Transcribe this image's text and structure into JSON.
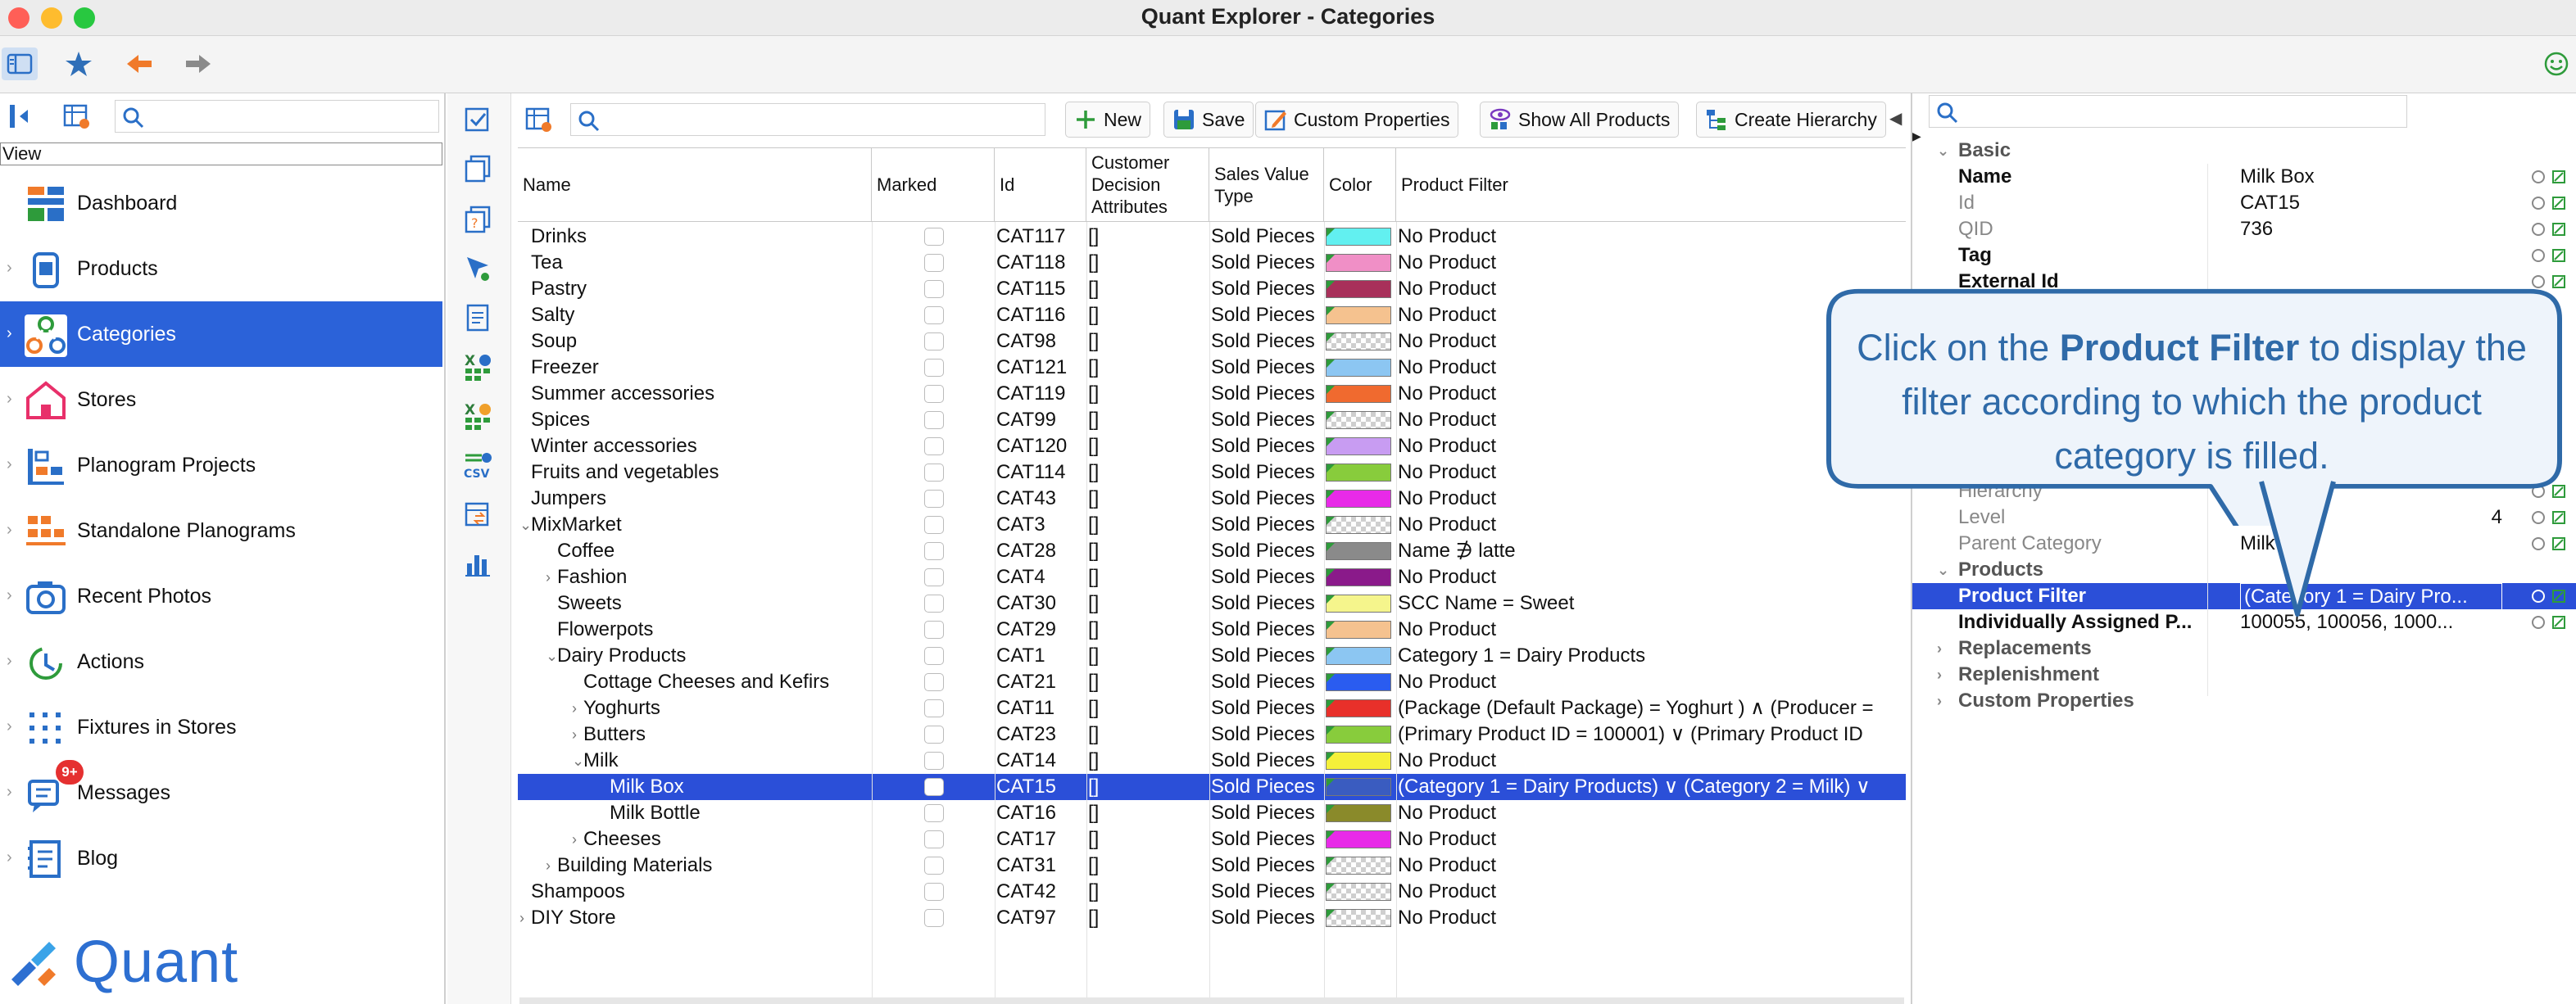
{
  "window": {
    "title": "Quant Explorer - Categories"
  },
  "left_panel": {
    "view_label": "View",
    "nav_items": [
      {
        "label": "Dashboard",
        "icon": "dashboard-icon"
      },
      {
        "label": "Products",
        "icon": "products-icon"
      },
      {
        "label": "Categories",
        "icon": "categories-icon"
      },
      {
        "label": "Stores",
        "icon": "stores-icon"
      },
      {
        "label": "Planogram Projects",
        "icon": "planogram-projects-icon"
      },
      {
        "label": "Standalone Planograms",
        "icon": "standalone-planograms-icon"
      },
      {
        "label": "Recent Photos",
        "icon": "camera-icon"
      },
      {
        "label": "Actions",
        "icon": "actions-icon"
      },
      {
        "label": "Fixtures in Stores",
        "icon": "fixtures-icon"
      },
      {
        "label": "Messages",
        "icon": "messages-icon"
      },
      {
        "label": "Blog",
        "icon": "blog-icon"
      }
    ],
    "messages_badge": "9+",
    "logo_text": "Quant",
    "selected": "Categories"
  },
  "toolbar": {
    "new_label": "New",
    "save_label": "Save",
    "custom_properties_label": "Custom Properties",
    "show_all_products_label": "Show All Products",
    "create_hierarchy_label": "Create Hierarchy"
  },
  "table": {
    "columns": [
      "Name",
      "Marked",
      "Id",
      "Customer Decision Attributes",
      "Sales Value Type",
      "Color",
      "Product Filter"
    ],
    "rows": [
      {
        "name": "Drinks",
        "indent": 0,
        "expander": "",
        "id": "CAT117",
        "cda": "[]",
        "svt": "Sold Pieces",
        "color": "#62f0f0",
        "filter": "No Product"
      },
      {
        "name": "Tea",
        "indent": 0,
        "expander": "",
        "id": "CAT118",
        "cda": "[]",
        "svt": "Sold Pieces",
        "color": "#f08fc6",
        "filter": "No Product"
      },
      {
        "name": "Pastry",
        "indent": 0,
        "expander": "",
        "id": "CAT115",
        "cda": "[]",
        "svt": "Sold Pieces",
        "color": "#a8305a",
        "filter": "No Product"
      },
      {
        "name": "Salty",
        "indent": 0,
        "expander": "",
        "id": "CAT116",
        "cda": "[]",
        "svt": "Sold Pieces",
        "color": "#f5c28f",
        "filter": "No Product"
      },
      {
        "name": "Soup",
        "indent": 0,
        "expander": "",
        "id": "CAT98",
        "cda": "[]",
        "svt": "Sold Pieces",
        "color": "checker",
        "filter": "No Product"
      },
      {
        "name": "Freezer",
        "indent": 0,
        "expander": "",
        "id": "CAT121",
        "cda": "[]",
        "svt": "Sold Pieces",
        "color": "#8cc6f2",
        "filter": "No Product"
      },
      {
        "name": "Summer accessories",
        "indent": 0,
        "expander": "",
        "id": "CAT119",
        "cda": "[]",
        "svt": "Sold Pieces",
        "color": "#f06a2f",
        "filter": "No Product"
      },
      {
        "name": "Spices",
        "indent": 0,
        "expander": "",
        "id": "CAT99",
        "cda": "[]",
        "svt": "Sold Pieces",
        "color": "checker",
        "filter": "No Product"
      },
      {
        "name": "Winter accessories",
        "indent": 0,
        "expander": "",
        "id": "CAT120",
        "cda": "[]",
        "svt": "Sold Pieces",
        "color": "#c89cf2",
        "filter": "No Product"
      },
      {
        "name": "Fruits and vegetables",
        "indent": 0,
        "expander": "",
        "id": "CAT114",
        "cda": "[]",
        "svt": "Sold Pieces",
        "color": "#88cc3c",
        "filter": "No Product"
      },
      {
        "name": "Jumpers",
        "indent": 0,
        "expander": "",
        "id": "CAT43",
        "cda": "[]",
        "svt": "Sold Pieces",
        "color": "#e82ae8",
        "filter": "No Product"
      },
      {
        "name": "MixMarket",
        "indent": 0,
        "expander": "v",
        "id": "CAT3",
        "cda": "[]",
        "svt": "Sold Pieces",
        "color": "checker",
        "filter": "No Product"
      },
      {
        "name": "Coffee",
        "indent": 1,
        "expander": "",
        "id": "CAT28",
        "cda": "[]",
        "svt": "Sold Pieces",
        "color": "#8a8a8a",
        "filter": "Name ∌ latte"
      },
      {
        "name": "Fashion",
        "indent": 1,
        "expander": ">",
        "id": "CAT4",
        "cda": "[]",
        "svt": "Sold Pieces",
        "color": "#8a1a8a",
        "filter": "No Product"
      },
      {
        "name": "Sweets",
        "indent": 1,
        "expander": "",
        "id": "CAT30",
        "cda": "[]",
        "svt": "Sold Pieces",
        "color": "#f5f58c",
        "filter": "SCC Name = Sweet"
      },
      {
        "name": "Flowerpots",
        "indent": 1,
        "expander": "",
        "id": "CAT29",
        "cda": "[]",
        "svt": "Sold Pieces",
        "color": "#f5c28f",
        "filter": "No Product"
      },
      {
        "name": "Dairy Products",
        "indent": 1,
        "expander": "v",
        "id": "CAT1",
        "cda": "[]",
        "svt": "Sold Pieces",
        "color": "#8cc6f2",
        "filter": "Category 1 = Dairy Products"
      },
      {
        "name": "Cottage Cheeses and Kefirs",
        "indent": 2,
        "expander": "",
        "id": "CAT21",
        "cda": "[]",
        "svt": "Sold Pieces",
        "color": "#2a5cf0",
        "filter": "No Product"
      },
      {
        "name": "Yoghurts",
        "indent": 2,
        "expander": ">",
        "id": "CAT11",
        "cda": "[]",
        "svt": "Sold Pieces",
        "color": "#e8302a",
        "filter": "(Package (Default Package) = Yoghurt ) ∧ (Producer ="
      },
      {
        "name": "Butters",
        "indent": 2,
        "expander": ">",
        "id": "CAT23",
        "cda": "[]",
        "svt": "Sold Pieces",
        "color": "#88cc3c",
        "filter": "(Primary Product ID = 100001) ∨ (Primary Product ID"
      },
      {
        "name": "Milk",
        "indent": 2,
        "expander": "v",
        "id": "CAT14",
        "cda": "[]",
        "svt": "Sold Pieces",
        "color": "#f5f03a",
        "filter": "No Product"
      },
      {
        "name": "Milk Box",
        "indent": 3,
        "expander": "",
        "id": "CAT15",
        "cda": "[]",
        "svt": "Sold Pieces",
        "color": "#3a5cc0",
        "filter": "(Category 1 = Dairy Products) ∨ (Category 2 = Milk) ∨",
        "selected": true
      },
      {
        "name": "Milk Bottle",
        "indent": 3,
        "expander": "",
        "id": "CAT16",
        "cda": "[]",
        "svt": "Sold Pieces",
        "color": "#8a8a2a",
        "filter": "No Product"
      },
      {
        "name": "Cheeses",
        "indent": 2,
        "expander": ">",
        "id": "CAT17",
        "cda": "[]",
        "svt": "Sold Pieces",
        "color": "#e82ae8",
        "filter": "No Product"
      },
      {
        "name": "Building Materials",
        "indent": 1,
        "expander": ">",
        "id": "CAT31",
        "cda": "[]",
        "svt": "Sold Pieces",
        "color": "checker",
        "filter": "No Product"
      },
      {
        "name": "Shampoos",
        "indent": 0,
        "expander": "",
        "id": "CAT42",
        "cda": "[]",
        "svt": "Sold Pieces",
        "color": "checker",
        "filter": "No Product"
      },
      {
        "name": "DIY Store",
        "indent": 0,
        "expander": ">",
        "id": "CAT97",
        "cda": "[]",
        "svt": "Sold Pieces",
        "color": "checker",
        "filter": "No Product"
      }
    ]
  },
  "properties": {
    "rows": [
      {
        "kind": "section",
        "name": "Basic",
        "open": true
      },
      {
        "kind": "prop",
        "name": "Name",
        "value": "Milk Box",
        "style": "bold"
      },
      {
        "kind": "prop",
        "name": "Id",
        "value": "CAT15",
        "style": "grey"
      },
      {
        "kind": "prop",
        "name": "QID",
        "value": "736",
        "style": "grey"
      },
      {
        "kind": "prop",
        "name": "Tag",
        "value": "",
        "style": "bold"
      },
      {
        "kind": "prop",
        "name": "External Id",
        "value": "",
        "style": "bold"
      },
      {
        "kind": "gap"
      },
      {
        "kind": "gap"
      },
      {
        "kind": "gap"
      },
      {
        "kind": "gap"
      },
      {
        "kind": "gap"
      },
      {
        "kind": "gap"
      },
      {
        "kind": "gap"
      },
      {
        "kind": "prop",
        "name": "Hierarchy",
        "value": "",
        "style": "grey"
      },
      {
        "kind": "prop",
        "name": "Level",
        "value": "4",
        "style": "grey",
        "align": "right"
      },
      {
        "kind": "prop",
        "name": "Parent Category",
        "value": "Milk",
        "style": "grey"
      },
      {
        "kind": "section",
        "name": "Products",
        "open": true
      },
      {
        "kind": "prop",
        "name": "Product Filter",
        "value": "(Category 1 = Dairy Pro...",
        "style": "bold",
        "selected": true
      },
      {
        "kind": "prop",
        "name": "Individually Assigned P...",
        "value": "100055, 100056, 1000...",
        "style": "bold"
      },
      {
        "kind": "section",
        "name": "Replacements",
        "open": false
      },
      {
        "kind": "section",
        "name": "Replenishment",
        "open": false
      },
      {
        "kind": "section",
        "name": "Custom Properties",
        "open": false
      }
    ]
  },
  "callout": {
    "pre": "Click on the ",
    "bold": "Product Filter",
    "post": " to display the filter according to which the product category is filled."
  },
  "colors": {
    "selection": "#2b4fd8",
    "nav_selection": "#2b62d9",
    "callout_border": "#2f6aa8",
    "callout_fill": "#eef4fb"
  }
}
